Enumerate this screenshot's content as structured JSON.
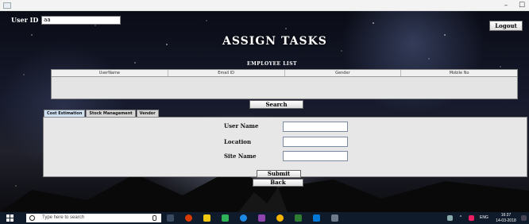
{
  "window": {
    "controls": {
      "minimize": "–",
      "maximize": "☐"
    }
  },
  "header": {
    "user_id_label": "User ID",
    "user_id_value": "aa",
    "logout_label": "Logout",
    "title": "ASSIGN TASKS"
  },
  "employee_list": {
    "title": "EMPLOYEE  LIST",
    "columns": [
      "UserName",
      "Email ID",
      "Gender",
      "Mobile No"
    ]
  },
  "search_button": "Search",
  "tabs": [
    {
      "label": "Cost Estimation",
      "active": true
    },
    {
      "label": "Stock Management",
      "active": false
    },
    {
      "label": "Vendor",
      "active": false
    }
  ],
  "form": {
    "user_name_label": "User Name",
    "location_label": "Location",
    "site_name_label": "Site Name",
    "submit_label": "Submit",
    "back_label": "Back"
  },
  "taskbar": {
    "search_placeholder": "Type here to search",
    "language": "ENG",
    "time": "16:37",
    "date": "14-03-2018"
  },
  "colors": {
    "taskbar": "#0f1a2a",
    "active_tab": "#cfe1f3",
    "panel": "#e7e7e7"
  }
}
